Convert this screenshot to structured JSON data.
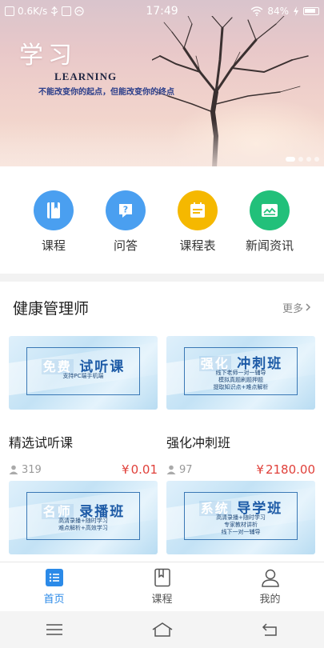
{
  "status_bar": {
    "speed": "0.6K/s",
    "time": "17:49",
    "battery": "84%"
  },
  "banner": {
    "title": "学习",
    "english": "LEARNING",
    "slogan": "不能改变你的起点，但能改变你的终点",
    "slide_count": 4,
    "active_slide": 1
  },
  "quick_nav": [
    {
      "label": "课程",
      "icon": "book-icon",
      "color": "#4a9ff0"
    },
    {
      "label": "问答",
      "icon": "question-icon",
      "color": "#4a9ff0"
    },
    {
      "label": "课程表",
      "icon": "schedule-icon",
      "color": "#f5b800"
    },
    {
      "label": "新闻资讯",
      "icon": "news-icon",
      "color": "#22c07a"
    }
  ],
  "section": {
    "title": "健康管理师",
    "more": "更多"
  },
  "courses": [
    {
      "title": "精选试听课",
      "count": "319",
      "price": "0.01",
      "thumb": {
        "tag": "免费",
        "name": "试听课",
        "lines": [
          "支持PC端手机端"
        ]
      }
    },
    {
      "title": "强化冲刺班",
      "count": "97",
      "price": "2180.00",
      "thumb": {
        "tag": "强化",
        "name": "冲刺班",
        "lines": [
          "线下老师一对一辅导",
          "模拟真题刷题押题",
          "提取知识点+难点解析"
        ]
      }
    },
    {
      "title": "",
      "count": "",
      "price": "",
      "thumb": {
        "tag": "名师",
        "name": "录播班",
        "lines": [
          "高清录播+随时学习",
          "难点解析+高效学习"
        ]
      }
    },
    {
      "title": "",
      "count": "",
      "price": "",
      "thumb": {
        "tag": "系统",
        "name": "导学班",
        "lines": [
          "高清录播+随时学习",
          "专家教材讲析",
          "线下一对一辅导"
        ]
      }
    }
  ],
  "currency": "¥",
  "tabs": [
    {
      "label": "首页",
      "icon": "home-list-icon",
      "active": true
    },
    {
      "label": "课程",
      "icon": "bookmark-book-icon",
      "active": false
    },
    {
      "label": "我的",
      "icon": "person-icon",
      "active": false
    }
  ],
  "colors": {
    "accent": "#2b8ae8",
    "price": "#e0403a"
  }
}
